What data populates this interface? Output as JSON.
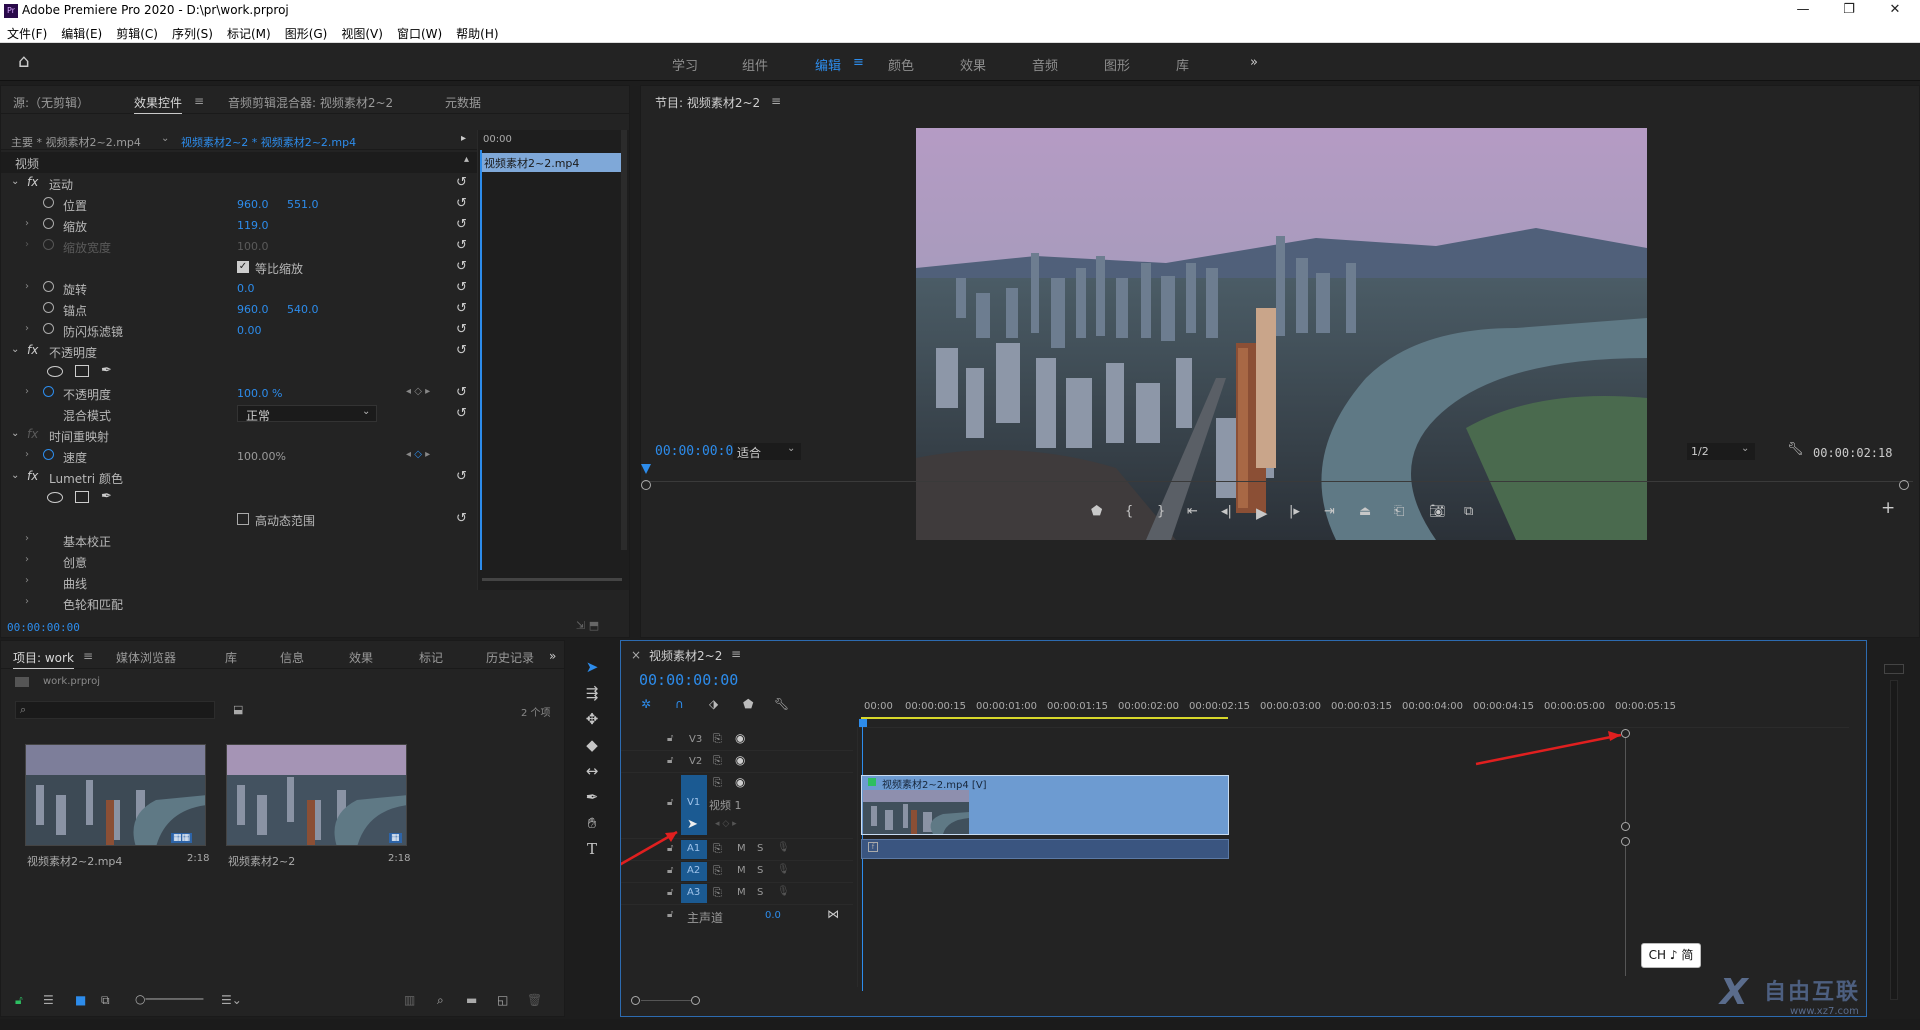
{
  "titlebar": {
    "title": "Adobe Premiere Pro 2020 - D:\\pr\\work.prproj",
    "logo": "Pr"
  },
  "menu": [
    "文件(F)",
    "编辑(E)",
    "剪辑(C)",
    "序列(S)",
    "标记(M)",
    "图形(G)",
    "视图(V)",
    "窗口(W)",
    "帮助(H)"
  ],
  "workspaces": [
    "学习",
    "组件",
    "编辑",
    "颜色",
    "效果",
    "音频",
    "图形",
    "库"
  ],
  "workspace_active": "编辑",
  "source_panel": {
    "tabs": [
      "源:（无剪辑）",
      "效果控件",
      "音频剪辑混合器: 视频素材2~2",
      "元数据"
    ],
    "master": "主要 * 视频素材2~2.mp4",
    "clip": "视频素材2~2 * 视频素材2~2.mp4",
    "mini_timecode": "00:00",
    "mini_clip": "视频素材2~2.mp4",
    "section_video": "视频",
    "motion": "运动",
    "position": {
      "label": "位置",
      "x": "960.0",
      "y": "551.0"
    },
    "scale": {
      "label": "缩放",
      "value": "119.0"
    },
    "scale_width": {
      "label": "缩放宽度",
      "value": "100.0"
    },
    "uniform_scale": "等比缩放",
    "rotation": {
      "label": "旋转",
      "value": "0.0"
    },
    "anchor": {
      "label": "锚点",
      "x": "960.0",
      "y": "540.0"
    },
    "antiflicker": {
      "label": "防闪烁滤镜",
      "value": "0.00"
    },
    "opacity_section": "不透明度",
    "opacity": {
      "label": "不透明度",
      "value": "100.0 %"
    },
    "blend": {
      "label": "混合模式",
      "value": "正常"
    },
    "time_remap": "时间重映射",
    "speed": {
      "label": "速度",
      "value": "100.00%"
    },
    "lumetri": "Lumetri 颜色",
    "hdr": "高动态范围",
    "basic": "基本校正",
    "creative": "创意",
    "curves": "曲线",
    "wheels": "色轮和匹配",
    "timecode": "00:00:00:00"
  },
  "program": {
    "title": "节目: 视频素材2~2",
    "timecode": "00:00:00:00",
    "fit": "适合",
    "resolution": "1/2",
    "duration": "00:00:02:18"
  },
  "project": {
    "tabs": [
      "项目: work",
      "媒体浏览器",
      "库",
      "信息",
      "效果",
      "标记",
      "历史记录"
    ],
    "file": "work.prproj",
    "count": "2 个项",
    "items": [
      {
        "name": "视频素材2~2.mp4",
        "duration": "2:18"
      },
      {
        "name": "视频素材2~2",
        "duration": "2:18"
      }
    ]
  },
  "timeline": {
    "title": "视频素材2~2",
    "timecode": "00:00:00:00",
    "ruler": [
      "00:00",
      "00:00:00:15",
      "00:00:01:00",
      "00:00:01:15",
      "00:00:02:00",
      "00:00:02:15",
      "00:00:03:00",
      "00:00:03:15",
      "00:00:04:00",
      "00:00:04:15",
      "00:00:05:00",
      "00:00:05:15"
    ],
    "tracks": {
      "v3": "V3",
      "v2": "V2",
      "v1": "V1",
      "v1_name": "视频 1",
      "a1": "A1",
      "a2": "A2",
      "a3": "A3",
      "master": "主声道",
      "master_val": "0.0"
    },
    "m": "M",
    "s": "S",
    "clip_label": "视频素材2~2.mp4 [V]"
  },
  "ime": "CH ♪ 简",
  "watermark": {
    "text": "自由互联",
    "url": "www.xz7.com"
  },
  "colors": {
    "accent": "#2d8ceb",
    "clip": "#6d9bd1",
    "audio_clip": "#3a5580",
    "arrow": "#e01f1f"
  }
}
